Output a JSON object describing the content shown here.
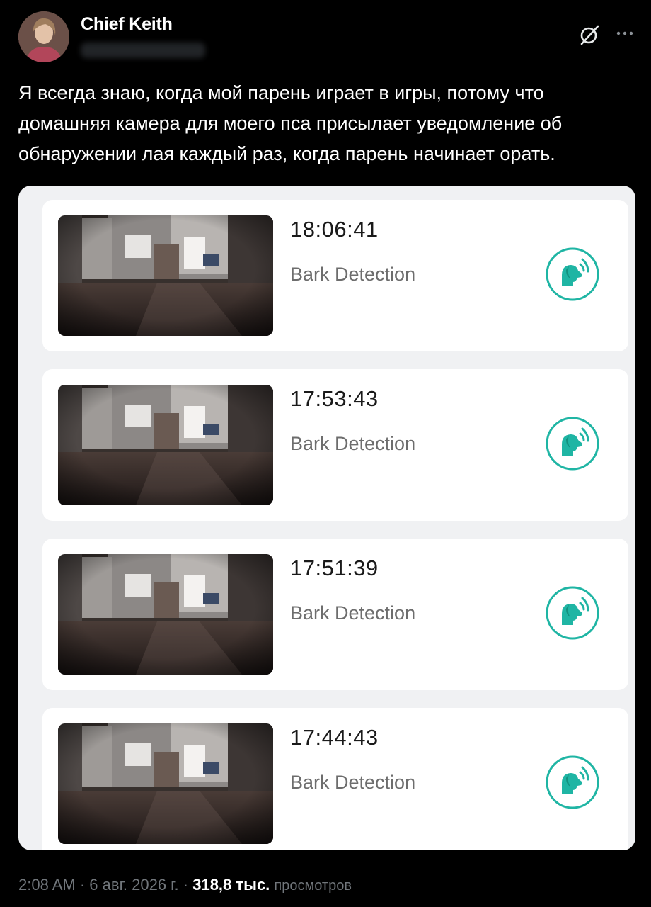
{
  "post": {
    "author_name": "Chief Keith",
    "text": "Я всегда знаю, когда мой парень играет в игры, потому что домашняя камера для моего пса присылает уведомление об обнаружении лая каждый раз, когда парень начинает орать."
  },
  "icons": {
    "grok": "grok-slash-circle-icon",
    "more": "more-dots-icon",
    "bark": "dog-barking-icon"
  },
  "colors": {
    "accent": "#1fb5a4",
    "background": "#000000",
    "card": "#ffffff"
  },
  "events": [
    {
      "time": "18:06:41",
      "label": "Bark Detection"
    },
    {
      "time": "17:53:43",
      "label": "Bark Detection"
    },
    {
      "time": "17:51:39",
      "label": "Bark Detection"
    },
    {
      "time": "17:44:43",
      "label": "Bark Detection"
    }
  ],
  "footer": {
    "time": "2:08 AM",
    "date": "6 авг. 2026 г.",
    "separator": "·",
    "views_count": "318,8 тыс.",
    "views_label": "просмотров"
  }
}
